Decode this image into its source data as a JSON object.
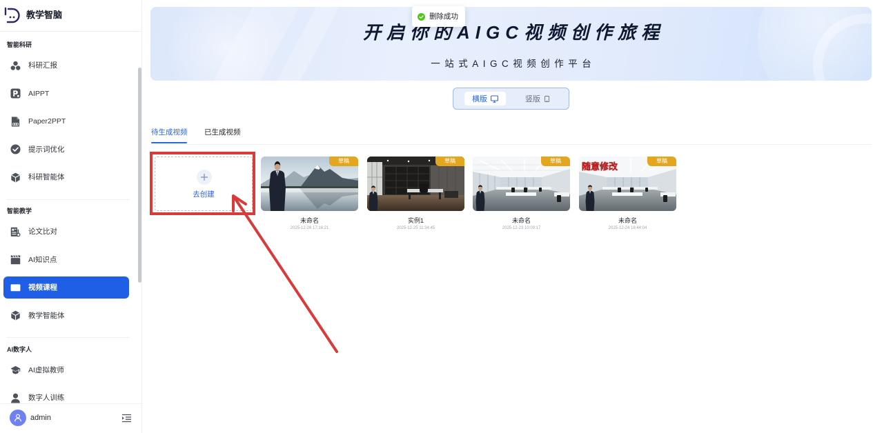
{
  "app": {
    "title": "教学智脑"
  },
  "toast": {
    "text": "删除成功",
    "icon": "check-circle-icon",
    "color": "#52c41a"
  },
  "sidebar": {
    "sections": [
      {
        "heading": "智能科研",
        "items": [
          {
            "label": "科研汇报",
            "icon": "cluster-icon"
          },
          {
            "label": "AIPPT",
            "icon": "ppt-icon"
          },
          {
            "label": "Paper2PPT",
            "icon": "paper-ppt-icon"
          },
          {
            "label": "提示词优化",
            "icon": "check-circle-icon"
          },
          {
            "label": "科研智能体",
            "icon": "cube-icon"
          }
        ]
      },
      {
        "heading": "智能教学",
        "items": [
          {
            "label": "论文比对",
            "icon": "compare-document-icon"
          },
          {
            "label": "AI知识点",
            "icon": "clapperboard-icon"
          },
          {
            "label": "视频课程",
            "icon": "screen-icon",
            "active": true
          },
          {
            "label": "教学智能体",
            "icon": "cube-icon"
          }
        ]
      },
      {
        "heading": "AI数字人",
        "items": [
          {
            "label": "AI虚拟教师",
            "icon": "graduation-cap-icon"
          },
          {
            "label": "数字人训练",
            "icon": "person-icon"
          }
        ]
      }
    ],
    "user": {
      "name": "admin",
      "avatar_icon": "user-icon"
    },
    "collapse_icon": "menu-fold-icon",
    "active_color": "#1f5fe6"
  },
  "banner": {
    "title": "开启你的AIGC视频创作旅程",
    "subtitle": "一站式AIGC视频创作平台"
  },
  "orientation": {
    "options": [
      {
        "label": "横版",
        "icon": "monitor-icon",
        "selected": true
      },
      {
        "label": "竖版",
        "icon": "phone-icon",
        "selected": false
      }
    ]
  },
  "tabs": [
    {
      "label": "待生成视频",
      "active": true
    },
    {
      "label": "已生成视频",
      "active": false
    }
  ],
  "create_card": {
    "label": "去创建",
    "icon": "plus-icon"
  },
  "videos": [
    {
      "title": "未命名",
      "time": "2025-12-26 17:16:21",
      "badge": "草稿"
    },
    {
      "title": "实例1",
      "time": "2025-12-25 11:34:45",
      "badge": "草稿"
    },
    {
      "title": "未命名",
      "time": "2025-12-23 10:09:17",
      "badge": "草稿"
    },
    {
      "title": "未命名",
      "time": "2025-12-24 16:44:04",
      "badge": "草稿",
      "overlay_text": "随意修改"
    }
  ],
  "colors": {
    "primary": "#2c66e0",
    "badge": "#e4a51f",
    "annotation": "#d93b3b"
  }
}
